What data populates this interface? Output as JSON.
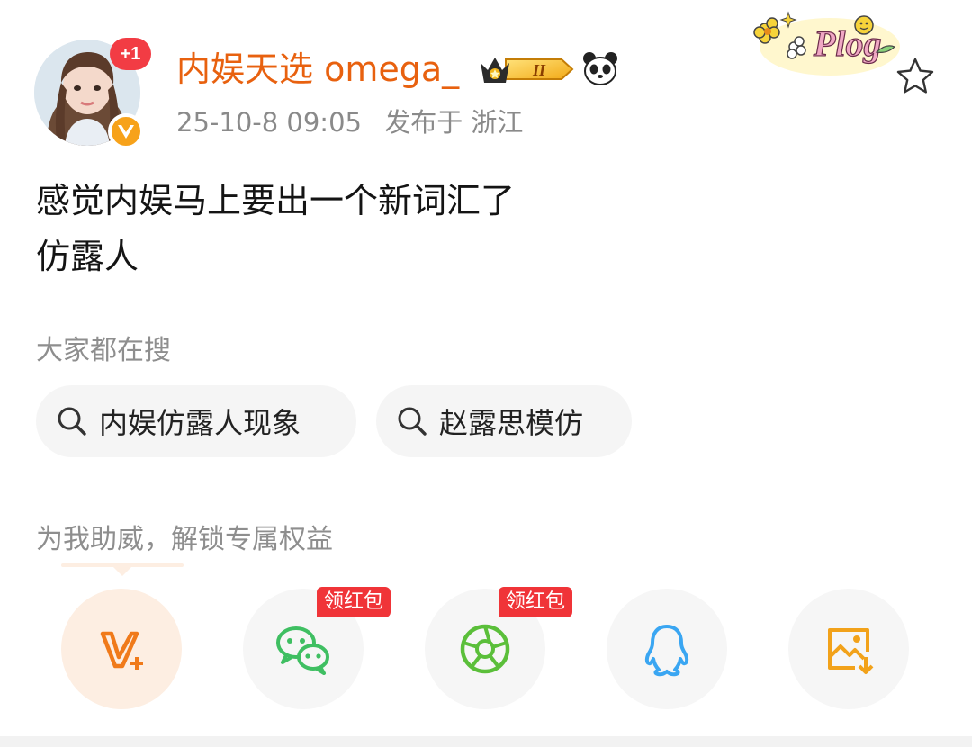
{
  "post": {
    "avatar_badge": "+1",
    "username": "内娱天选 omega_",
    "level": "II",
    "timestamp": "25-10-8 09:05",
    "location": "发布于 浙江",
    "sticker_text": "Plog",
    "text_line1": "感觉内娱马上要出一个新词汇了",
    "text_line2": "仿露人"
  },
  "search": {
    "label": "大家都在搜",
    "chips": [
      "内娱仿露人现象",
      "赵露思模仿"
    ]
  },
  "support": {
    "label": "为我助威，解锁专属权益",
    "red_packet_label": "领红包",
    "share_icons": [
      "v-plus-icon",
      "wechat-icon",
      "moments-icon",
      "qq-icon",
      "save-image-icon"
    ]
  },
  "colors": {
    "username": "#e8610f",
    "meta": "#8a8a8a",
    "red_packet": "#f03438",
    "v_badge": "#f7a21a",
    "wechat": "#3fbf62",
    "moments": "#5bbf3a",
    "qq": "#3aa6f2",
    "vplus": "#f07a1a"
  }
}
